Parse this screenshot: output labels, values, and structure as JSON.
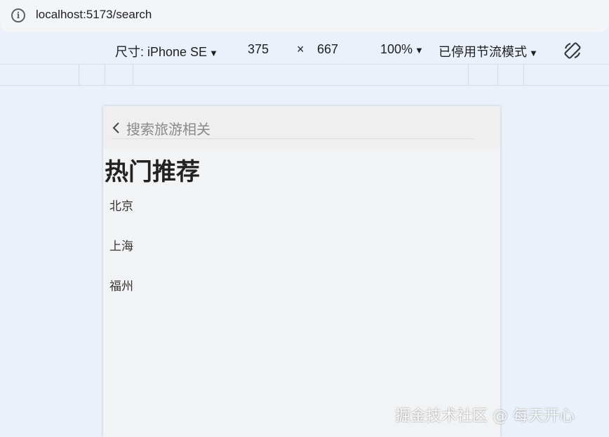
{
  "browser": {
    "url": "localhost:5173/search"
  },
  "device_toolbar": {
    "device": "尺寸: iPhone SE",
    "width": "375",
    "times": "×",
    "height": "667",
    "zoom": "100%",
    "throttling": "已停用节流模式"
  },
  "page": {
    "search_placeholder": "搜索旅游相关",
    "section_title": "热门推荐",
    "cities": [
      "北京",
      "上海",
      "福州"
    ]
  },
  "watermark": "掘金技术社区 @ 每天开心",
  "colors": {
    "toolbar_bg": "#eaf1fb",
    "page_bg": "#f1f3f5",
    "header_bg": "#efefef"
  }
}
